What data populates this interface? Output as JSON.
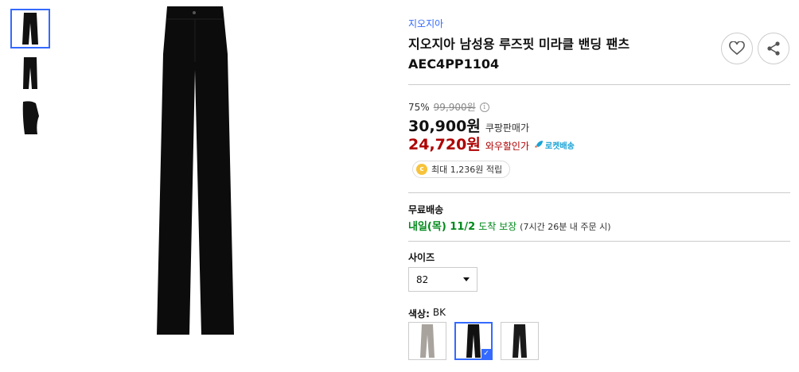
{
  "gallery": {
    "thumbnails": [
      {
        "name": "thumb-front",
        "color": "#111111"
      },
      {
        "name": "thumb-back",
        "color": "#111111"
      },
      {
        "name": "thumb-detail",
        "color": "#111111"
      }
    ],
    "main_color": "#0c0c0c"
  },
  "product": {
    "brand": "지오지아",
    "title": "지오지아 남성용 루즈핏 미라클 밴딩 팬츠 AEC4PP1104"
  },
  "price": {
    "discount_rate": "75%",
    "original_price": "99,900원",
    "info_glyph": "i",
    "sale_price": "30,900원",
    "sale_label": "쿠팡판매가",
    "wow_price": "24,720원",
    "wow_label": "와우할인가",
    "rocket_label": "로켓배송"
  },
  "points": {
    "coin_glyph": "c",
    "text": "최대 1,236원 적립"
  },
  "shipping": {
    "label": "무료배송",
    "date": "내일(목) 11/2",
    "guarantee": "도착 보장",
    "note": "(7시간 26분 내 주문 시)"
  },
  "options": {
    "size_label": "사이즈",
    "size_value": "82",
    "color_label": "색상:",
    "color_value": "BK",
    "swatches": [
      {
        "name": "swatch-gray",
        "color": "#a8a39d",
        "selected": false
      },
      {
        "name": "swatch-black",
        "color": "#111111",
        "selected": true
      },
      {
        "name": "swatch-black-alt",
        "color": "#1a1a1a",
        "selected": false
      }
    ],
    "check_glyph": "✓"
  },
  "colors": {
    "accent": "#346aff",
    "wow_red": "#ae0000",
    "delivery_green": "#00891a"
  }
}
